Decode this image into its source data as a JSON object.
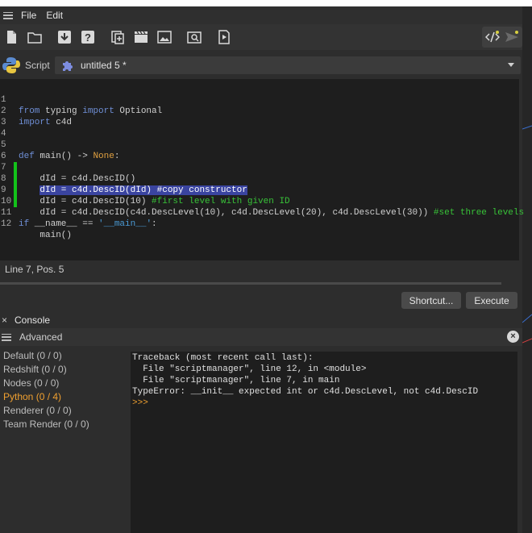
{
  "menu": {
    "items": [
      "File",
      "Edit"
    ]
  },
  "toolbar": {
    "icons": [
      "new-file-icon",
      "open-folder-icon",
      "download-icon",
      "help-icon",
      "add-icon",
      "clapper-icon",
      "image-icon",
      "folder-search-icon",
      "play-icon",
      "code-icon",
      "send-icon"
    ]
  },
  "script": {
    "label": "Script",
    "selected": "untitled 5 *"
  },
  "editor": {
    "lines": [
      {
        "n": "1",
        "text": "from typing import Optional"
      },
      {
        "n": "2",
        "text": "import c4d"
      },
      {
        "n": "3",
        "text": ""
      },
      {
        "n": "4",
        "text": ""
      },
      {
        "n": "5",
        "text": "def main() -> None:"
      },
      {
        "n": "6",
        "text": "    dId = c4d.DescID()"
      },
      {
        "n": "7",
        "text": "    dId = c4d.DescID(dId) #copy constructor"
      },
      {
        "n": "8",
        "text": "    dId = c4d.DescID(10) #first level with given ID"
      },
      {
        "n": "9",
        "text": "    dId = c4d.DescID(c4d.DescLevel(10), c4d.DescLevel(20), c4d.DescLevel(30)) #set three levels"
      },
      {
        "n": "10",
        "text": ""
      },
      {
        "n": "11",
        "text": "if __name__ == '__main__':"
      },
      {
        "n": "12",
        "text": "    main()"
      }
    ]
  },
  "status": {
    "position": "Line 7, Pos. 5"
  },
  "buttons": {
    "shortcut": "Shortcut...",
    "execute": "Execute"
  },
  "console": {
    "tab_label": "Console",
    "close_glyph": "×",
    "panel_label": "Advanced",
    "sidebar": [
      {
        "label": "Default (0 / 0)",
        "active": false
      },
      {
        "label": "Redshift (0 / 0)",
        "active": false
      },
      {
        "label": "Nodes (0 / 0)",
        "active": false
      },
      {
        "label": "Python (0 / 4)",
        "active": true
      },
      {
        "label": "Renderer (0 / 0)",
        "active": false
      },
      {
        "label": "Team Render  (0 / 0)",
        "active": false
      }
    ],
    "output": [
      "Traceback (most recent call last):",
      "  File \"scriptmanager\", line 12, in <module>",
      "  File \"scriptmanager\", line 7, in main",
      "TypeError: __init__ expected int or c4d.DescLevel, not c4d.DescID"
    ],
    "prompt": ">>>"
  },
  "colors": {
    "accent": "#f0a030",
    "marker": "#13c21a",
    "selection": "#3a44a0"
  }
}
